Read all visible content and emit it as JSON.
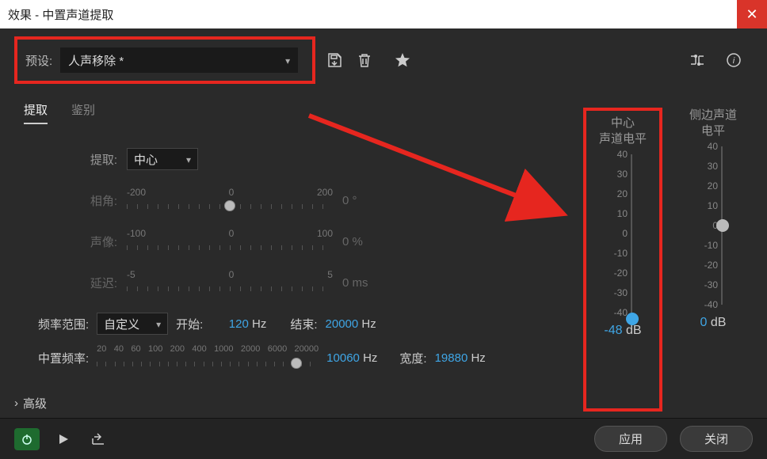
{
  "window": {
    "title": "效果 - 中置声道提取"
  },
  "preset": {
    "label": "预设:",
    "value": "人声移除 *"
  },
  "toolbar": {
    "save_icon": "save-icon",
    "trash_icon": "trash-icon",
    "star_icon": "star-icon",
    "route_icon": "routing-icon",
    "info_icon": "info-icon"
  },
  "tabs": {
    "extract": "提取",
    "discriminate": "鉴别"
  },
  "extract": {
    "extract_label": "提取:",
    "extract_value": "中心",
    "phase_label": "相角:",
    "phase_ticks": [
      "-200",
      "0",
      "200"
    ],
    "phase_value": "0",
    "phase_unit": "°",
    "pan_label": "声像:",
    "pan_ticks": [
      "-100",
      "0",
      "100"
    ],
    "pan_value": "0",
    "pan_unit": "%",
    "delay_label": "延迟:",
    "delay_ticks": [
      "-5",
      "0",
      "5"
    ],
    "delay_value": "0",
    "delay_unit": "ms",
    "freq_range_label": "频率范围:",
    "freq_range_value": "自定义",
    "start_label": "开始:",
    "start_value": "120",
    "start_unit": "Hz",
    "end_label": "结束:",
    "end_value": "20000",
    "end_unit": "Hz",
    "center_freq_label": "中置频率:",
    "center_ticks": [
      "20",
      "40",
      "60",
      "100",
      "200",
      "400",
      "1000",
      "2000",
      "6000",
      "20000"
    ],
    "center_value": "10060",
    "center_unit": "Hz",
    "width_label": "宽度:",
    "width_value": "19880",
    "width_unit": "Hz"
  },
  "advanced": {
    "label": "高级"
  },
  "vsliders": {
    "center": {
      "title_l1": "中心",
      "title_l2": "声道电平",
      "ticks": [
        "40",
        "30",
        "20",
        "10",
        "0",
        "-10",
        "-20",
        "-30",
        "-40"
      ],
      "value": "-48",
      "unit": "dB"
    },
    "side": {
      "title_l1": "侧边声道",
      "title_l2": "电平",
      "ticks": [
        "40",
        "30",
        "20",
        "10",
        "0",
        "-10",
        "-20",
        "-30",
        "-40"
      ],
      "value": "0",
      "unit": "dB"
    }
  },
  "footer": {
    "apply": "应用",
    "close": "关闭"
  }
}
